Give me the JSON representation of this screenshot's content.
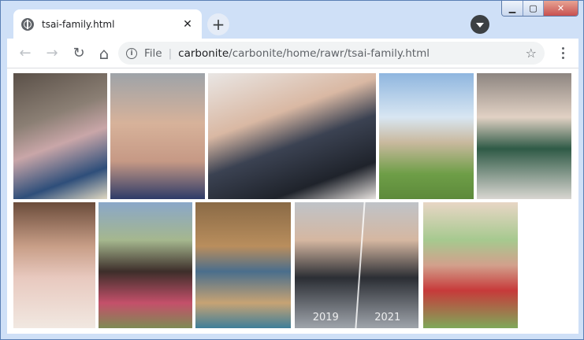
{
  "window": {
    "controls": {
      "minimize": "▁",
      "maximize": "▢",
      "close": "✕"
    }
  },
  "tab": {
    "title": "tsai-family.html",
    "close": "✕"
  },
  "new_tab": "+",
  "toolbar": {
    "back": "←",
    "forward": "→",
    "reload": "↻",
    "home": "⌂",
    "info": "i",
    "scheme": "File",
    "host": "carbonite",
    "path": "/carbonite/home/rawr/tsai-family.html",
    "star": "☆"
  },
  "gallery": {
    "photos": [
      {
        "id": "p1",
        "bg": "linear-gradient(160deg,#5a5048 0%,#8b7f74 35%,#c9a6a8 55%,#2e4e7a 80%,#e0d8c2 100%)"
      },
      {
        "id": "p2",
        "bg": "linear-gradient(180deg,#9ea3a8 0%,#d7b29a 40%,#c69985 70%,#2e3b68 100%)"
      },
      {
        "id": "p3",
        "bg": "linear-gradient(160deg,#e9e6e4 0%,#d9b8a3 35%,#3b4252 55%,#1f232b 80%,#e7e2df 100%)"
      },
      {
        "id": "p4",
        "bg": "linear-gradient(180deg,#8fb6df 0%,#d8e6f2 35%,#c9b99e 55%,#6e9e47 80%,#5d8a3b 100%)"
      },
      {
        "id": "p5",
        "bg": "linear-gradient(180deg,#8d8580 0%,#e1d1c4 35%,#2f5a46 60%,#d9d6d1 100%)"
      },
      {
        "id": "p6",
        "bg": "linear-gradient(180deg,#6b4c3b 0%,#c89e87 35%,#e8c9bf 60%,#f1e8e1 100%)"
      },
      {
        "id": "p7",
        "bg": "linear-gradient(180deg,#8aa7c9 0%,#a5b78e 30%,#3d2e2a 55%,#c4506a 80%,#7f8a55 100%)"
      },
      {
        "id": "p8",
        "bg": "linear-gradient(180deg,#8a6a46 0%,#b98e5d 35%,#4a6e8c 55%,#c7a374 80%,#3e7e99 100%)"
      },
      {
        "id": "p9",
        "bg": "linear-gradient(180deg,#bfc3c8 0%,#d5b7a1 30%,#2b2e34 60%,#9fa4ab 100%)",
        "labels": [
          "2019",
          "2021"
        ]
      },
      {
        "id": "p10",
        "bg": "linear-gradient(180deg,#e8d6c5 0%,#a6c98f 30%,#d2a08c 50%,#c73a3a 70%,#7fa85a 100%)"
      }
    ]
  }
}
